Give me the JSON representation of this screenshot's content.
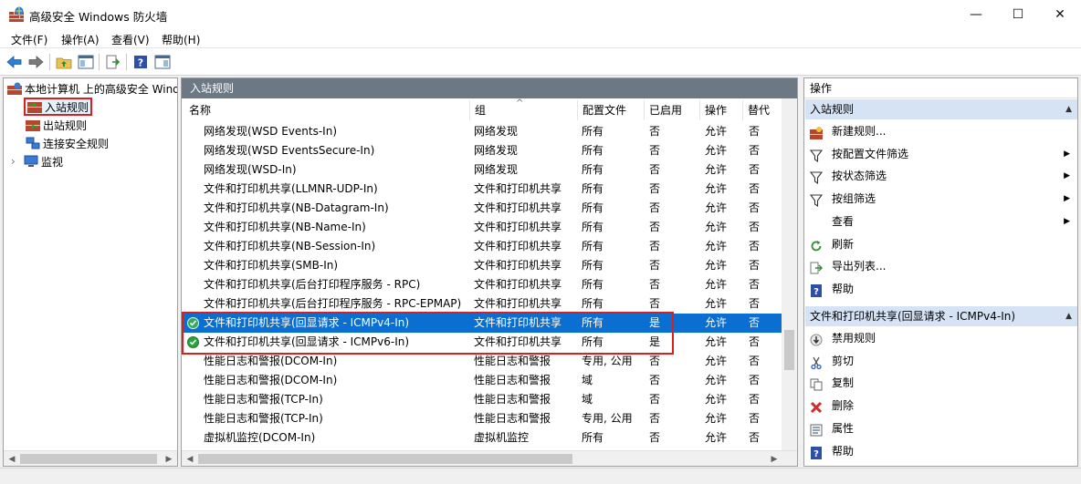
{
  "window": {
    "title": "高级安全 Windows 防火墙",
    "minimize_glyph": "—",
    "maximize_glyph": "☐",
    "close_glyph": "✕"
  },
  "menu": [
    "文件(F)",
    "操作(A)",
    "查看(V)",
    "帮助(H)"
  ],
  "toolbar": {
    "icons": [
      "back-arrow-icon",
      "forward-arrow-icon",
      "folder-up-icon",
      "show-hide-tree-icon",
      "export-icon",
      "help-icon",
      "panel-icon"
    ]
  },
  "tree": {
    "root": "本地计算机 上的高级安全 Windows 防火墙",
    "items": [
      "入站规则",
      "出站规则",
      "连接安全规则",
      "监视"
    ],
    "expander": "›"
  },
  "center": {
    "header": "入站规则",
    "columns": [
      "名称",
      "组",
      "配置文件",
      "已启用",
      "操作",
      "替代"
    ],
    "sort_glyph": "^",
    "rows": [
      {
        "name": "网络发现(WSD Events-In)",
        "group": "网络发现",
        "profile": "所有",
        "enabled": "否",
        "action": "允许",
        "override": "否",
        "state": "none"
      },
      {
        "name": "网络发现(WSD EventsSecure-In)",
        "group": "网络发现",
        "profile": "所有",
        "enabled": "否",
        "action": "允许",
        "override": "否",
        "state": "none"
      },
      {
        "name": "网络发现(WSD-In)",
        "group": "网络发现",
        "profile": "所有",
        "enabled": "否",
        "action": "允许",
        "override": "否",
        "state": "none"
      },
      {
        "name": "文件和打印机共享(LLMNR-UDP-In)",
        "group": "文件和打印机共享",
        "profile": "所有",
        "enabled": "否",
        "action": "允许",
        "override": "否",
        "state": "none"
      },
      {
        "name": "文件和打印机共享(NB-Datagram-In)",
        "group": "文件和打印机共享",
        "profile": "所有",
        "enabled": "否",
        "action": "允许",
        "override": "否",
        "state": "none"
      },
      {
        "name": "文件和打印机共享(NB-Name-In)",
        "group": "文件和打印机共享",
        "profile": "所有",
        "enabled": "否",
        "action": "允许",
        "override": "否",
        "state": "none"
      },
      {
        "name": "文件和打印机共享(NB-Session-In)",
        "group": "文件和打印机共享",
        "profile": "所有",
        "enabled": "否",
        "action": "允许",
        "override": "否",
        "state": "none"
      },
      {
        "name": "文件和打印机共享(SMB-In)",
        "group": "文件和打印机共享",
        "profile": "所有",
        "enabled": "否",
        "action": "允许",
        "override": "否",
        "state": "none"
      },
      {
        "name": "文件和打印机共享(后台打印程序服务 - RPC)",
        "group": "文件和打印机共享",
        "profile": "所有",
        "enabled": "否",
        "action": "允许",
        "override": "否",
        "state": "none"
      },
      {
        "name": "文件和打印机共享(后台打印程序服务 - RPC-EPMAP)",
        "group": "文件和打印机共享",
        "profile": "所有",
        "enabled": "否",
        "action": "允许",
        "override": "否",
        "state": "none"
      },
      {
        "name": "文件和打印机共享(回显请求 - ICMPv4-In)",
        "group": "文件和打印机共享",
        "profile": "所有",
        "enabled": "是",
        "action": "允许",
        "override": "否",
        "state": "selected"
      },
      {
        "name": "文件和打印机共享(回显请求 - ICMPv6-In)",
        "group": "文件和打印机共享",
        "profile": "所有",
        "enabled": "是",
        "action": "允许",
        "override": "否",
        "state": "enabled"
      },
      {
        "name": "性能日志和警报(DCOM-In)",
        "group": "性能日志和警报",
        "profile": "专用, 公用",
        "enabled": "否",
        "action": "允许",
        "override": "否",
        "state": "none"
      },
      {
        "name": "性能日志和警报(DCOM-In)",
        "group": "性能日志和警报",
        "profile": "域",
        "enabled": "否",
        "action": "允许",
        "override": "否",
        "state": "none"
      },
      {
        "name": "性能日志和警报(TCP-In)",
        "group": "性能日志和警报",
        "profile": "域",
        "enabled": "否",
        "action": "允许",
        "override": "否",
        "state": "none"
      },
      {
        "name": "性能日志和警报(TCP-In)",
        "group": "性能日志和警报",
        "profile": "专用, 公用",
        "enabled": "否",
        "action": "允许",
        "override": "否",
        "state": "none"
      },
      {
        "name": "虚拟机监控(DCOM-In)",
        "group": "虚拟机监控",
        "profile": "所有",
        "enabled": "否",
        "action": "允许",
        "override": "否",
        "state": "none"
      }
    ]
  },
  "actions": {
    "header": "操作",
    "section1": {
      "title": "入站规则",
      "items": [
        {
          "label": "新建规则...",
          "icon": "new-rule-icon",
          "submenu": false
        },
        {
          "label": "按配置文件筛选",
          "icon": "filter-icon",
          "submenu": true
        },
        {
          "label": "按状态筛选",
          "icon": "filter-icon",
          "submenu": true
        },
        {
          "label": "按组筛选",
          "icon": "filter-icon",
          "submenu": true
        },
        {
          "label": "查看",
          "icon": "none",
          "submenu": true
        },
        {
          "label": "刷新",
          "icon": "refresh-icon",
          "submenu": false
        },
        {
          "label": "导出列表...",
          "icon": "export-icon",
          "submenu": false
        },
        {
          "label": "帮助",
          "icon": "help-icon",
          "submenu": false
        }
      ]
    },
    "section2": {
      "title": "文件和打印机共享(回显请求 - ICMPv4-In)",
      "items": [
        {
          "label": "禁用规则",
          "icon": "disable-icon"
        },
        {
          "label": "剪切",
          "icon": "cut-icon"
        },
        {
          "label": "复制",
          "icon": "copy-icon"
        },
        {
          "label": "删除",
          "icon": "delete-icon"
        },
        {
          "label": "属性",
          "icon": "properties-icon"
        },
        {
          "label": "帮助",
          "icon": "help-icon"
        }
      ]
    },
    "arrow_glyph": "▶",
    "collapse_glyph": "▲"
  },
  "colors": {
    "selection": "#0a6fd1",
    "highlight_border": "#d9201e",
    "section_header": "#d6e3f5",
    "pane_header": "#6d7885"
  }
}
